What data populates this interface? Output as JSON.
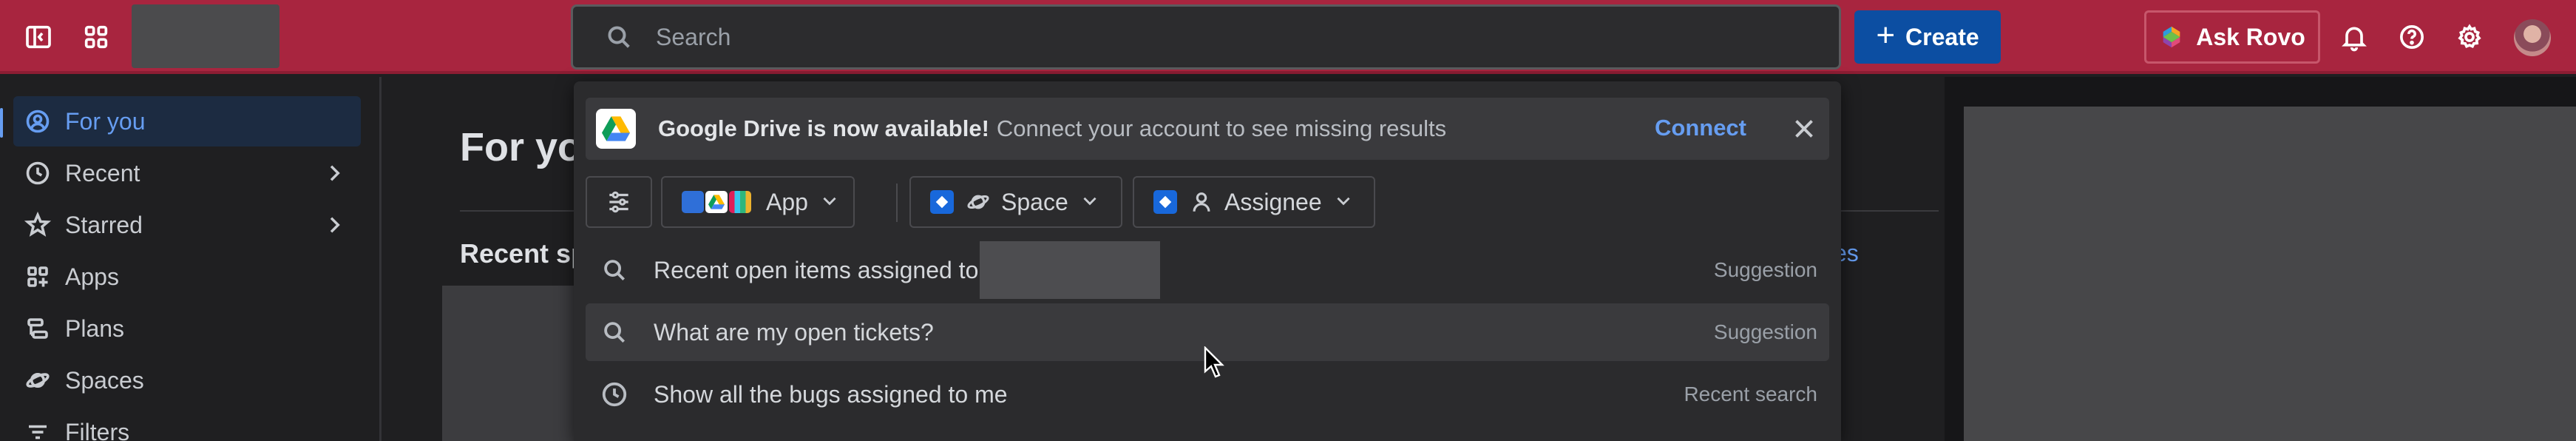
{
  "topbar": {
    "search_placeholder": "Search",
    "create_label": "Create",
    "ask_rovo_label": "Ask Rovo",
    "brand_color": "#a8253f",
    "icons": [
      "sidebar-toggle-icon",
      "app-switcher-icon",
      "search-icon",
      "plus-icon",
      "rovo-icon",
      "bell-icon",
      "help-icon",
      "gear-icon"
    ]
  },
  "sidebar": {
    "items": [
      {
        "label": "For you",
        "icon": "user-circle-icon",
        "active": true
      },
      {
        "label": "Recent",
        "icon": "clock-icon",
        "has_chevron": true
      },
      {
        "label": "Starred",
        "icon": "star-icon",
        "has_chevron": true
      },
      {
        "label": "Apps",
        "icon": "apps-icon"
      },
      {
        "label": "Plans",
        "icon": "plans-icon"
      },
      {
        "label": "Spaces",
        "icon": "planet-icon"
      },
      {
        "label": "Filters",
        "icon": "filter-icon"
      }
    ]
  },
  "main": {
    "title": "For you",
    "recent_spaces_label": "Recent spaces",
    "peek_link": "es"
  },
  "dropdown": {
    "banner": {
      "title": "Google Drive is now available!",
      "text": "Connect your account to see missing results",
      "connect_label": "Connect"
    },
    "filters": {
      "app_label": "App",
      "space_label": "Space",
      "assignee_label": "Assignee"
    },
    "results": [
      {
        "text": "Recent open items assigned to",
        "meta": "Suggestion",
        "icon": "search-icon",
        "redacted_suffix": true
      },
      {
        "text": "What are my open tickets?",
        "meta": "Suggestion",
        "icon": "search-icon",
        "hover": true
      },
      {
        "text": "Show all the bugs assigned to me",
        "meta": "Recent search",
        "icon": "clock-icon"
      }
    ]
  }
}
